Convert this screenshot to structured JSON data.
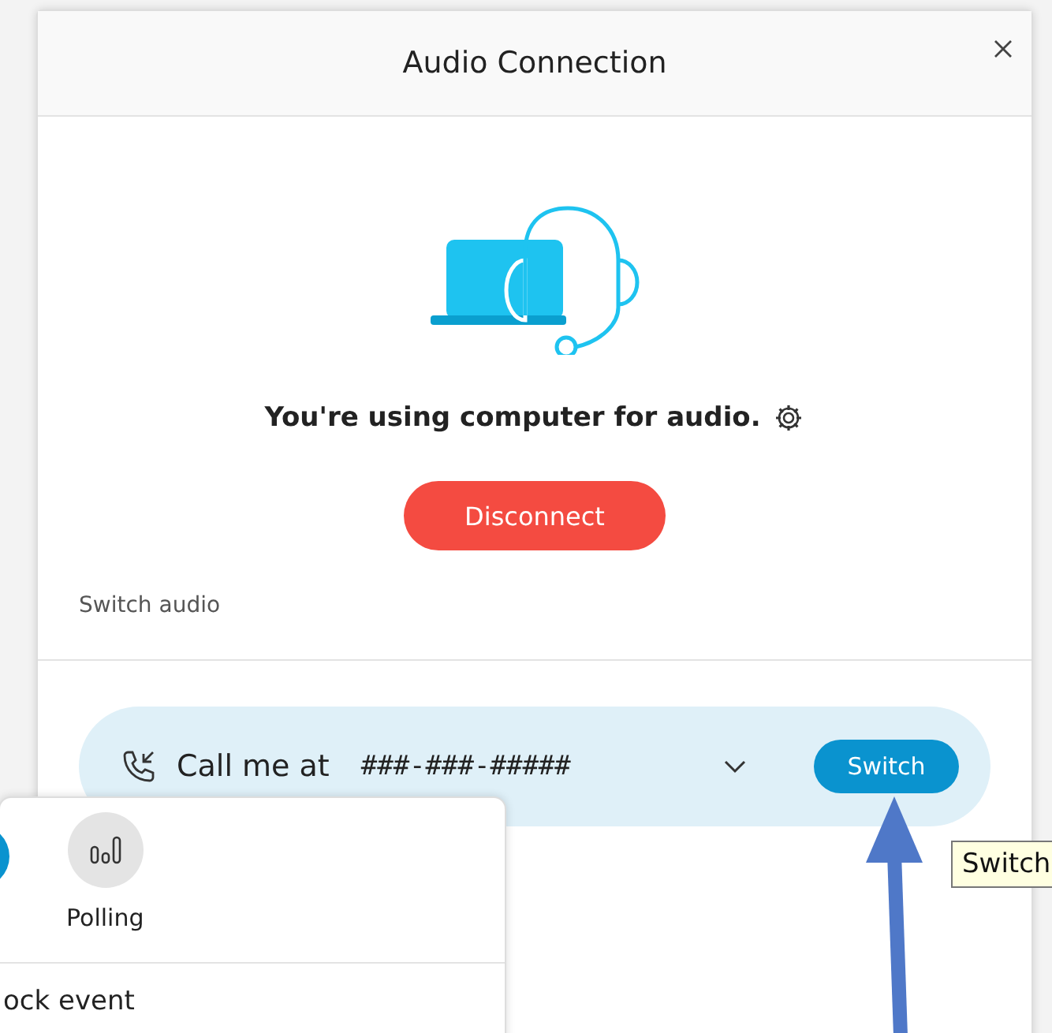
{
  "dialog": {
    "title": "Audio Connection",
    "status": "You're using computer for audio.",
    "disconnect_button": "Disconnect",
    "section_label": "Switch audio",
    "audio_options": [
      {
        "label": "Call me at",
        "number": "###-###-#####",
        "switch_button": "Switch",
        "selected": true
      }
    ]
  },
  "popup": {
    "buttons": [
      {
        "label": "Polling"
      }
    ],
    "menu_items": [
      "ock event"
    ]
  },
  "tooltip": "Switch"
}
